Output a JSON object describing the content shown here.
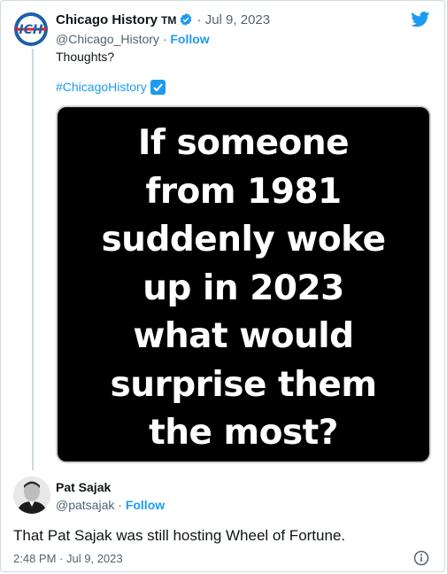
{
  "tweet": {
    "author_name": "Chicago History",
    "author_suffix": "TM",
    "separator": "·",
    "date": "Jul 9, 2023",
    "handle": "@Chicago_History",
    "follow_label": "Follow",
    "text": "Thoughts?",
    "hashtag": "#ChicagoHistory",
    "avatar_text": "ICH",
    "media_lines": [
      "If someone",
      "from 1981",
      "suddenly woke",
      "up in 2023",
      "what would",
      "surprise them",
      "the most?"
    ]
  },
  "reply": {
    "author_name": "Pat Sajak",
    "handle": "@patsajak",
    "separator": "·",
    "follow_label": "Follow",
    "text": "That Pat Sajak was still hosting Wheel of Fortune.",
    "time": "2:48 PM",
    "date": "Jul 9, 2023"
  },
  "colors": {
    "link_blue": "#1d9bf0",
    "secondary_text": "#536471",
    "primary_text": "#0f1419",
    "media_bg": "#000000"
  },
  "icons": {
    "brand": "twitter-bird-icon",
    "verified": "verified-badge-icon",
    "check": "check-mark-button-icon",
    "info": "info-icon"
  }
}
